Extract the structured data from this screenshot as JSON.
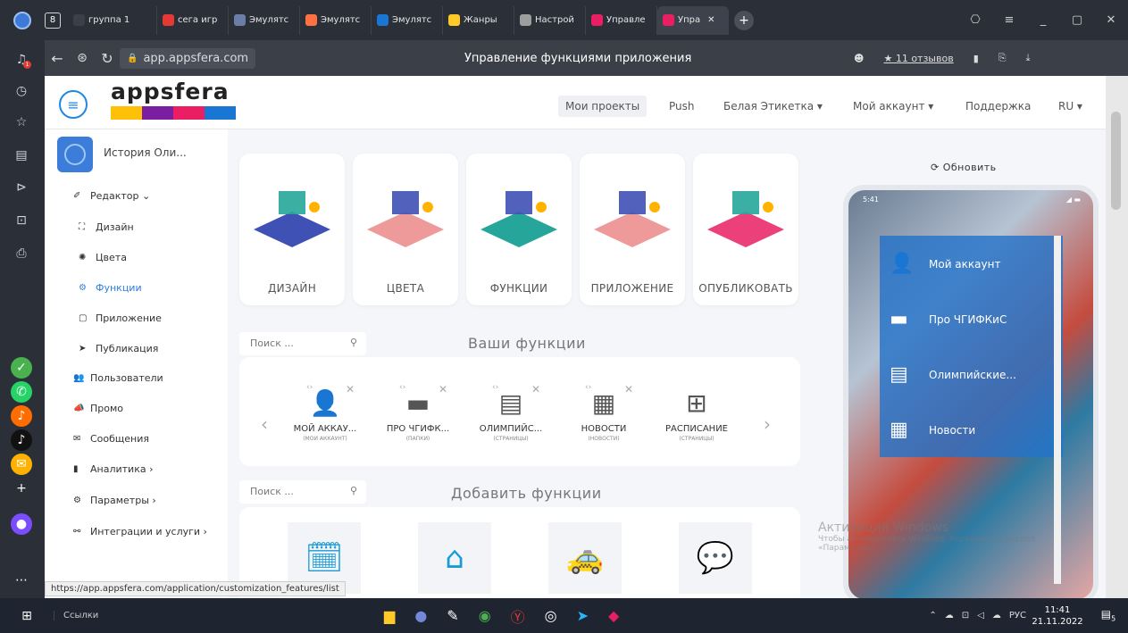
{
  "browser": {
    "tab_count": "8",
    "tabs": [
      {
        "label": "группа 1",
        "color": "#3a3f49"
      },
      {
        "label": "сега игр",
        "color": "#e53935"
      },
      {
        "label": "Эмулятс",
        "color": "#6a7ea8"
      },
      {
        "label": "Эмулятс",
        "color": "#ff7043"
      },
      {
        "label": "Эмулятс",
        "color": "#1976d2"
      },
      {
        "label": "Жанры",
        "color": "#ffca28"
      },
      {
        "label": "Настрой",
        "color": "#9e9e9e"
      },
      {
        "label": "Управле",
        "color": "#e91e63"
      },
      {
        "label": "Упра",
        "color": "#e91e63",
        "active": true
      }
    ],
    "url": "app.appsfera.com",
    "page_title": "Управление функциями приложения",
    "reviews": "★ 11 отзывов",
    "status_url": "https://app.appsfera.com/application/customization_features/list"
  },
  "brand": {
    "name": "appsfera",
    "stripe": [
      "#ffc107",
      "#7b1fa2",
      "#e91e63",
      "#1976d2"
    ]
  },
  "topnav": [
    "Мои проекты",
    "Push",
    "Белая Этикетка ▾",
    "Мой аккаунт ▾",
    "Поддержка",
    "RU ▾"
  ],
  "project": {
    "name": "История Оли..."
  },
  "leftnav": [
    {
      "label": "Редактор ⌄",
      "icon": "✐",
      "indent": 0
    },
    {
      "label": "Дизайн",
      "icon": "⛶",
      "indent": 1
    },
    {
      "label": "Цвета",
      "icon": "✺",
      "indent": 1
    },
    {
      "label": "Функции",
      "icon": "⚙",
      "indent": 1,
      "active": true
    },
    {
      "label": "Приложение",
      "icon": "▢",
      "indent": 1
    },
    {
      "label": "Публикация",
      "icon": "➤",
      "indent": 1
    },
    {
      "label": "Пользователи",
      "icon": "👥",
      "indent": 0
    },
    {
      "label": "Промо",
      "icon": "📣",
      "indent": 0
    },
    {
      "label": "Сообщения",
      "icon": "✉",
      "indent": 0
    },
    {
      "label": "Аналитика ›",
      "icon": "▮",
      "indent": 0
    },
    {
      "label": "Параметры ›",
      "icon": "⚙",
      "indent": 0
    },
    {
      "label": "Интеграции и услуги ›",
      "icon": "⚯",
      "indent": 0
    }
  ],
  "steps": [
    "ДИЗАЙН",
    "ЦВЕТА",
    "ФУНКЦИИ",
    "ПРИЛОЖЕНИЕ",
    "ОПУБЛИКОВАТЬ"
  ],
  "search_placeholder": "Поиск ...",
  "your_functions_title": "Ваши функции",
  "add_functions_title": "Добавить функции",
  "your_functions": [
    {
      "name": "МОЙ АККАУ...",
      "sub": "(МОИ АККАУНТ)",
      "icon": "user-icon"
    },
    {
      "name": "ПРО ЧГИФК...",
      "sub": "(ПАПКИ)",
      "icon": "folder-icon"
    },
    {
      "name": "ОЛИМПИЙС...",
      "sub": "(СТРАНИЦЫ)",
      "icon": "page-icon"
    },
    {
      "name": "НОВОСТИ",
      "sub": "(НОВОСТИ)",
      "icon": "news-icon"
    },
    {
      "name": "РАСПИСАНИЕ",
      "sub": "(СТРАНИЦЫ)",
      "icon": "grid-icon"
    }
  ],
  "add_functions_icons": [
    "schedule-icon",
    "bookmark-icon",
    "taxi-icon",
    "chat-icon"
  ],
  "preview": {
    "refresh": "Обновить",
    "time": "5:41",
    "menu": [
      "Мой аккаунт",
      "Про ЧГИФКиС",
      "Олимпийские...",
      "Новости"
    ]
  },
  "watermark": {
    "line1": "Активация Windows",
    "line2": "Чтобы активировать Windows, перейдите в раздел «Параметры»."
  },
  "taskbar": {
    "links": "Ссылки",
    "lang": "РУС",
    "time": "11:41",
    "date": "21.11.2022",
    "notif": "5"
  }
}
